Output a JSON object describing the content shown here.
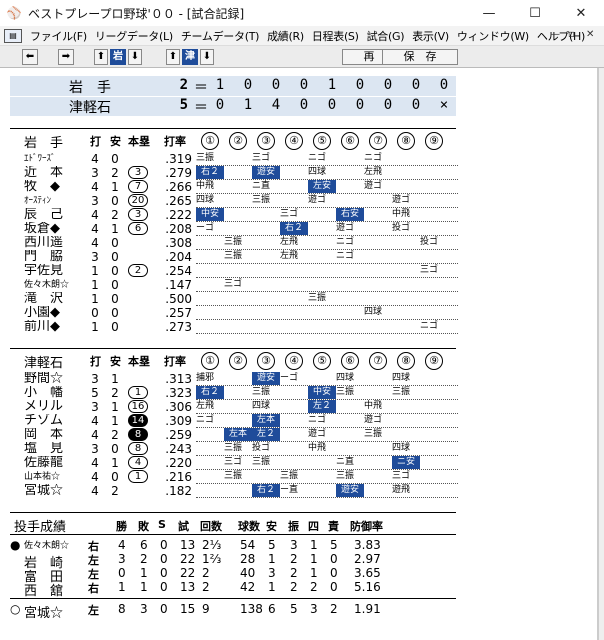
{
  "window": {
    "title": "ベストプレープロ野球'００ - [試合記録]",
    "icon": "baseball-app-icon",
    "min": "—",
    "max": "☐",
    "close": "✕"
  },
  "menu": {
    "items": [
      "ファイル(F)",
      "リーグデータ(L)",
      "チームデータ(T)",
      "成績(R)",
      "日程表(S)",
      "試合(G)",
      "表示(V)",
      "ウィンドウ(W)",
      "ヘルプ(H)"
    ],
    "mdi_min": "—",
    "mdi_restore": "▫",
    "mdi_close": "✕"
  },
  "toolbar": {
    "prev": "⬅",
    "next": "➡",
    "up1": "⬆",
    "team1": "岩",
    "down1": "⬇",
    "up2": "⬆",
    "team2": "津",
    "down2": "⬇",
    "replay": "再　生",
    "save": "保　存"
  },
  "score": {
    "rows": [
      {
        "team": "岩　手",
        "total": "2",
        "eq": "＝",
        "innings": [
          "1",
          "0",
          "0",
          "0",
          "1",
          "0",
          "0",
          "0",
          "0"
        ]
      },
      {
        "team": "津軽石",
        "total": "5",
        "eq": "＝",
        "innings": [
          "0",
          "1",
          "4",
          "0",
          "0",
          "0",
          "0",
          "0",
          "×"
        ]
      }
    ]
  },
  "batting": [
    {
      "team": "岩　手",
      "headers": {
        "ab": "打",
        "h": "安",
        "hr": "本塁",
        "avg": "打率"
      },
      "inning_heads": [
        "①",
        "②",
        "③",
        "④",
        "⑤",
        "⑥",
        "⑦",
        "⑧",
        "⑨"
      ],
      "players": [
        {
          "name": "ｴﾄﾞﾜｰｽﾞ",
          "small": true,
          "ab": "4",
          "h": "0",
          "hr": "",
          "hrstyle": "",
          "avg": ".319",
          "results": [
            {
              "i": 1,
              "t": "三振",
              "hit": false
            },
            {
              "i": 3,
              "t": "三ゴ",
              "hit": false
            },
            {
              "i": 5,
              "t": "ニゴ",
              "hit": false
            },
            {
              "i": 7,
              "t": "ニゴ",
              "hit": false
            }
          ]
        },
        {
          "name": "近　本",
          "ab": "3",
          "h": "2",
          "hr": "3",
          "hrstyle": "c",
          "avg": ".279",
          "results": [
            {
              "i": 1,
              "t": "右２",
              "hit": true
            },
            {
              "i": 3,
              "t": "遊安",
              "hit": true
            },
            {
              "i": 5,
              "t": "四球",
              "hit": false
            },
            {
              "i": 7,
              "t": "左飛",
              "hit": false
            }
          ]
        },
        {
          "name": "牧　◆",
          "ab": "4",
          "h": "1",
          "hr": "7",
          "hrstyle": "c",
          "avg": ".266",
          "results": [
            {
              "i": 1,
              "t": "中飛",
              "hit": false
            },
            {
              "i": 3,
              "t": "ニ直",
              "hit": false
            },
            {
              "i": 5,
              "t": "左安",
              "hit": true
            },
            {
              "i": 7,
              "t": "遊ゴ",
              "hit": false
            }
          ]
        },
        {
          "name": "ｵｰｽﾃｨﾝ",
          "small": true,
          "ab": "3",
          "h": "0",
          "hr": "20",
          "hrstyle": "c",
          "avg": ".265",
          "results": [
            {
              "i": 1,
              "t": "四球",
              "hit": false
            },
            {
              "i": 3,
              "t": "三振",
              "hit": false
            },
            {
              "i": 5,
              "t": "遊ゴ",
              "hit": false
            },
            {
              "i": 8,
              "t": "遊ゴ",
              "hit": false
            }
          ]
        },
        {
          "name": "辰　己",
          "ab": "4",
          "h": "2",
          "hr": "3",
          "hrstyle": "c",
          "avg": ".222",
          "results": [
            {
              "i": 1,
              "t": "中安",
              "hit": true
            },
            {
              "i": 4,
              "t": "三ゴ",
              "hit": false
            },
            {
              "i": 6,
              "t": "右安",
              "hit": true
            },
            {
              "i": 8,
              "t": "中飛",
              "hit": false
            }
          ]
        },
        {
          "name": "坂倉◆",
          "ab": "4",
          "h": "1",
          "hr": "6",
          "hrstyle": "c",
          "avg": ".208",
          "results": [
            {
              "i": 1,
              "t": "ーゴ",
              "hit": false
            },
            {
              "i": 4,
              "t": "右２",
              "hit": true
            },
            {
              "i": 6,
              "t": "遊ゴ",
              "hit": false
            },
            {
              "i": 8,
              "t": "投ゴ",
              "hit": false
            }
          ]
        },
        {
          "name": "西川遥",
          "ab": "4",
          "h": "0",
          "hr": "",
          "hrstyle": "",
          "avg": ".308",
          "results": [
            {
              "i": 2,
              "t": "三振",
              "hit": false
            },
            {
              "i": 4,
              "t": "左飛",
              "hit": false
            },
            {
              "i": 6,
              "t": "ニゴ",
              "hit": false
            },
            {
              "i": 9,
              "t": "投ゴ",
              "hit": false
            }
          ]
        },
        {
          "name": "門　脇",
          "ab": "3",
          "h": "0",
          "hr": "",
          "hrstyle": "",
          "avg": ".204",
          "results": [
            {
              "i": 2,
              "t": "三振",
              "hit": false
            },
            {
              "i": 4,
              "t": "左飛",
              "hit": false
            },
            {
              "i": 6,
              "t": "ニゴ",
              "hit": false
            }
          ]
        },
        {
          "name": "宇佐見",
          "ab": "1",
          "h": "0",
          "hr": "2",
          "hrstyle": "c",
          "avg": ".254",
          "results": [
            {
              "i": 9,
              "t": "三ゴ",
              "hit": false
            }
          ]
        },
        {
          "name": "佐々木朗☆",
          "small": true,
          "ab": "1",
          "h": "0",
          "hr": "",
          "hrstyle": "",
          "avg": ".147",
          "results": [
            {
              "i": 2,
              "t": "三ゴ",
              "hit": false
            }
          ]
        },
        {
          "name": "滝　沢",
          "ab": "1",
          "h": "0",
          "hr": "",
          "hrstyle": "",
          "avg": ".500",
          "results": [
            {
              "i": 5,
              "t": "三振",
              "hit": false
            }
          ]
        },
        {
          "name": "小園◆",
          "ab": "0",
          "h": "0",
          "hr": "",
          "hrstyle": "",
          "avg": ".257",
          "results": [
            {
              "i": 7,
              "t": "四球",
              "hit": false
            }
          ]
        },
        {
          "name": "前川◆",
          "ab": "1",
          "h": "0",
          "hr": "",
          "hrstyle": "",
          "avg": ".273",
          "results": [
            {
              "i": 9,
              "t": "ニゴ",
              "hit": false
            }
          ]
        }
      ]
    },
    {
      "team": "津軽石",
      "headers": {
        "ab": "打",
        "h": "安",
        "hr": "本塁",
        "avg": "打率"
      },
      "inning_heads": [
        "①",
        "②",
        "③",
        "④",
        "⑤",
        "⑥",
        "⑦",
        "⑧",
        "⑨"
      ],
      "players": [
        {
          "name": "野間☆",
          "ab": "3",
          "h": "1",
          "hr": "",
          "hrstyle": "",
          "avg": ".313",
          "results": [
            {
              "i": 1,
              "t": "捕邪",
              "hit": false
            },
            {
              "i": 3,
              "t": "遊安",
              "hit": true
            },
            {
              "i": 4,
              "t": "ーゴ",
              "hit": false
            },
            {
              "i": 6,
              "t": "四球",
              "hit": false
            },
            {
              "i": 8,
              "t": "四球",
              "hit": false
            }
          ]
        },
        {
          "name": "小　幡",
          "ab": "5",
          "h": "2",
          "hr": "1",
          "hrstyle": "c",
          "avg": ".323",
          "results": [
            {
              "i": 1,
              "t": "右２",
              "hit": true
            },
            {
              "i": 3,
              "t": "三振",
              "hit": false
            },
            {
              "i": 5,
              "t": "中安",
              "hit": true
            },
            {
              "i": 6,
              "t": "三振",
              "hit": false
            },
            {
              "i": 8,
              "t": "三振",
              "hit": false
            }
          ]
        },
        {
          "name": "メリル",
          "ab": "3",
          "h": "1",
          "hr": "16",
          "hrstyle": "c",
          "avg": ".306",
          "results": [
            {
              "i": 1,
              "t": "左飛",
              "hit": false
            },
            {
              "i": 3,
              "t": "四球",
              "hit": false
            },
            {
              "i": 5,
              "t": "左２",
              "hit": true
            },
            {
              "i": 7,
              "t": "中飛",
              "hit": false
            }
          ]
        },
        {
          "name": "チゾム",
          "ab": "4",
          "h": "1",
          "hr": "14",
          "hrstyle": "f",
          "avg": ".309",
          "results": [
            {
              "i": 1,
              "t": "ニゴ",
              "hit": false
            },
            {
              "i": 3,
              "t": "左本",
              "hit": true
            },
            {
              "i": 5,
              "t": "ニゴ",
              "hit": false
            },
            {
              "i": 7,
              "t": "遊ゴ",
              "hit": false
            }
          ]
        },
        {
          "name": "岡　本",
          "ab": "4",
          "h": "2",
          "hr": "8",
          "hrstyle": "f",
          "avg": ".259",
          "results": [
            {
              "i": 2,
              "t": "左本",
              "hit": true
            },
            {
              "i": 3,
              "t": "左２",
              "hit": true
            },
            {
              "i": 5,
              "t": "遊ゴ",
              "hit": false
            },
            {
              "i": 7,
              "t": "三振",
              "hit": false
            }
          ]
        },
        {
          "name": "塩　見",
          "ab": "3",
          "h": "0",
          "hr": "8",
          "hrstyle": "c",
          "avg": ".243",
          "results": [
            {
              "i": 2,
              "t": "三振",
              "hit": false
            },
            {
              "i": 3,
              "t": "投ゴ",
              "hit": false
            },
            {
              "i": 5,
              "t": "中飛",
              "hit": false
            },
            {
              "i": 8,
              "t": "四球",
              "hit": false
            }
          ]
        },
        {
          "name": "佐藤龍",
          "ab": "4",
          "h": "1",
          "hr": "4",
          "hrstyle": "c",
          "avg": ".220",
          "results": [
            {
              "i": 2,
              "t": "三ゴ",
              "hit": false
            },
            {
              "i": 3,
              "t": "三振",
              "hit": false
            },
            {
              "i": 6,
              "t": "ニ直",
              "hit": false
            },
            {
              "i": 8,
              "t": "ニ安",
              "hit": true
            }
          ]
        },
        {
          "name": "山本祐☆",
          "small": true,
          "ab": "4",
          "h": "0",
          "hr": "1",
          "hrstyle": "c",
          "avg": ".216",
          "results": [
            {
              "i": 2,
              "t": "三振",
              "hit": false
            },
            {
              "i": 4,
              "t": "三振",
              "hit": false
            },
            {
              "i": 6,
              "t": "三振",
              "hit": false
            },
            {
              "i": 8,
              "t": "三ゴ",
              "hit": false
            }
          ]
        },
        {
          "name": "宮城☆",
          "ab": "4",
          "h": "2",
          "hr": "",
          "hrstyle": "",
          "avg": ".182",
          "results": [
            {
              "i": 3,
              "t": "右２",
              "hit": true
            },
            {
              "i": 4,
              "t": "ー直",
              "hit": false
            },
            {
              "i": 6,
              "t": "遊安",
              "hit": true
            },
            {
              "i": 8,
              "t": "遊飛",
              "hit": false
            }
          ]
        }
      ]
    }
  ],
  "pitching": {
    "title": "投手成績",
    "headers": [
      "勝",
      "敗",
      "S",
      "試",
      "回数",
      "球数",
      "安",
      "振",
      "四",
      "責",
      "防御率"
    ],
    "rows": [
      {
        "mark": "●",
        "name": "佐々木朗☆",
        "small": true,
        "hand": "右",
        "w": "4",
        "l": "6",
        "s": "0",
        "g": "13",
        "ip": "2⅓",
        "np": "54",
        "h": "5",
        "so": "3",
        "bb": "1",
        "er": "5",
        "era": "3.83"
      },
      {
        "mark": "",
        "name": "岩　崎",
        "hand": "左",
        "w": "3",
        "l": "2",
        "s": "0",
        "g": "22",
        "ip": "1⅔",
        "np": "28",
        "h": "1",
        "so": "2",
        "bb": "1",
        "er": "0",
        "era": "2.97"
      },
      {
        "mark": "",
        "name": "富　田",
        "hand": "左",
        "w": "0",
        "l": "1",
        "s": "0",
        "g": "22",
        "ip": "2",
        "np": "40",
        "h": "3",
        "so": "2",
        "bb": "1",
        "er": "0",
        "era": "3.65"
      },
      {
        "mark": "",
        "name": "西　舘",
        "hand": "右",
        "w": "1",
        "l": "1",
        "s": "0",
        "g": "13",
        "ip": "2",
        "np": "42",
        "h": "1",
        "so": "2",
        "bb": "2",
        "er": "0",
        "era": "5.16"
      },
      {
        "mark": "○",
        "name": "宮城☆",
        "hand": "左",
        "w": "8",
        "l": "3",
        "s": "0",
        "g": "15",
        "ip": "9",
        "np": "138",
        "h": "6",
        "so": "5",
        "bb": "3",
        "er": "2",
        "era": "1.91"
      }
    ]
  }
}
